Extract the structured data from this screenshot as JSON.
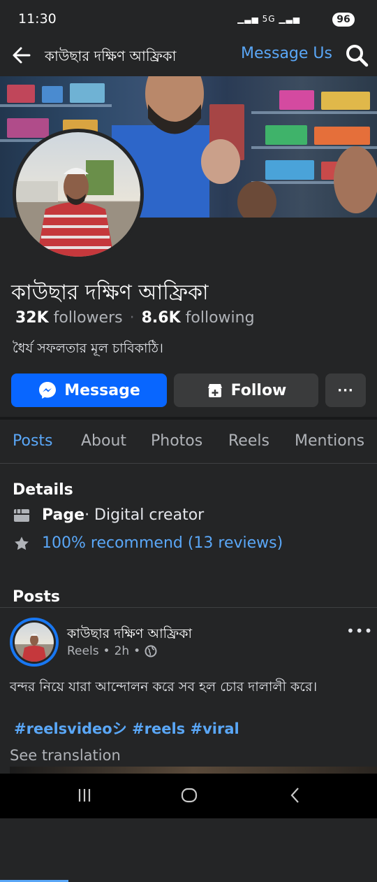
{
  "status": {
    "time": "11:30",
    "network": "5G",
    "battery": "96"
  },
  "topbar": {
    "title": "কাউছার দক্ষিণ আফ্রিকা",
    "message_us": "Message Us"
  },
  "profile": {
    "name": "কাউছার দক্ষিণ আফ্রিকা",
    "followers_count": "32K",
    "followers_label": "followers",
    "following_count": "8.6K",
    "following_label": "following",
    "bio": "ধৈর্য সফলতার মূল চাবিকাঠি।"
  },
  "actions": {
    "message": "Message",
    "follow": "Follow",
    "more": "···"
  },
  "tabs": [
    "Posts",
    "About",
    "Photos",
    "Reels",
    "Mentions"
  ],
  "details": {
    "heading": "Details",
    "page_label": "Page",
    "category": " · Digital creator",
    "recommend": "100% recommend (13 reviews)"
  },
  "posts": {
    "heading": "Posts",
    "author": "কাউছার দক্ষিণ আফ্রিকা",
    "source": "Reels",
    "time": "2h",
    "text": "বন্দর নিয়ে যারা আন্দোলন করে সব হল চোর দালালী করে।",
    "hashtags": "#reelsvideoシ #reels #viral",
    "see_translation": "See translation"
  },
  "colors": {
    "accent": "#0866ff",
    "link": "#5aa7f7",
    "background": "#242526"
  },
  "icons": [
    "back-arrow-icon",
    "search-icon",
    "messenger-icon",
    "follow-icon",
    "page-icon",
    "star-icon",
    "globe-icon",
    "recents-icon",
    "home-icon",
    "back-nav-icon"
  ]
}
